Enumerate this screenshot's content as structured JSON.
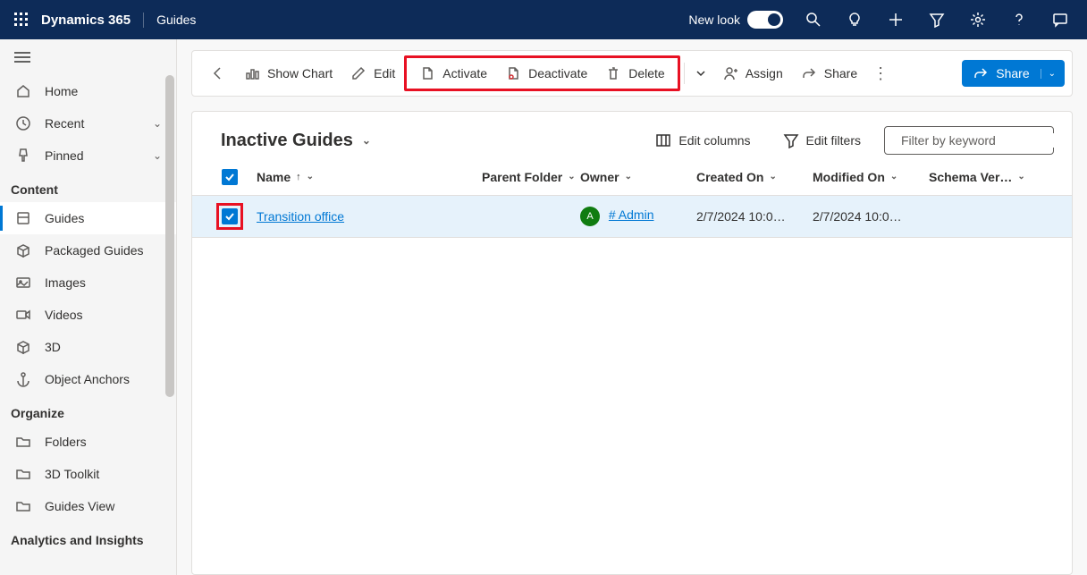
{
  "topbar": {
    "brand": "Dynamics 365",
    "app": "Guides",
    "newlook": "New look"
  },
  "sidebar": {
    "home": "Home",
    "recent": "Recent",
    "pinned": "Pinned",
    "section_content": "Content",
    "guides": "Guides",
    "packaged": "Packaged Guides",
    "images": "Images",
    "videos": "Videos",
    "three_d": "3D",
    "object_anchors": "Object Anchors",
    "section_organize": "Organize",
    "folders": "Folders",
    "toolkit": "3D Toolkit",
    "guides_view": "Guides View",
    "section_analytics": "Analytics and Insights"
  },
  "cmdbar": {
    "show_chart": "Show Chart",
    "edit": "Edit",
    "activate": "Activate",
    "deactivate": "Deactivate",
    "delete": "Delete",
    "assign": "Assign",
    "share": "Share",
    "share_primary": "Share"
  },
  "view": {
    "title": "Inactive Guides",
    "edit_columns": "Edit columns",
    "edit_filters": "Edit filters",
    "search_placeholder": "Filter by keyword"
  },
  "columns": {
    "name": "Name",
    "parent": "Parent Folder",
    "owner": "Owner",
    "created": "Created On",
    "modified": "Modified On",
    "schema": "Schema Ver…"
  },
  "rows": [
    {
      "name": "Transition office",
      "parent": "",
      "owner_initial": "A",
      "owner": "# Admin",
      "created": "2/7/2024 10:0…",
      "modified": "2/7/2024 10:0…",
      "schema": ""
    }
  ]
}
